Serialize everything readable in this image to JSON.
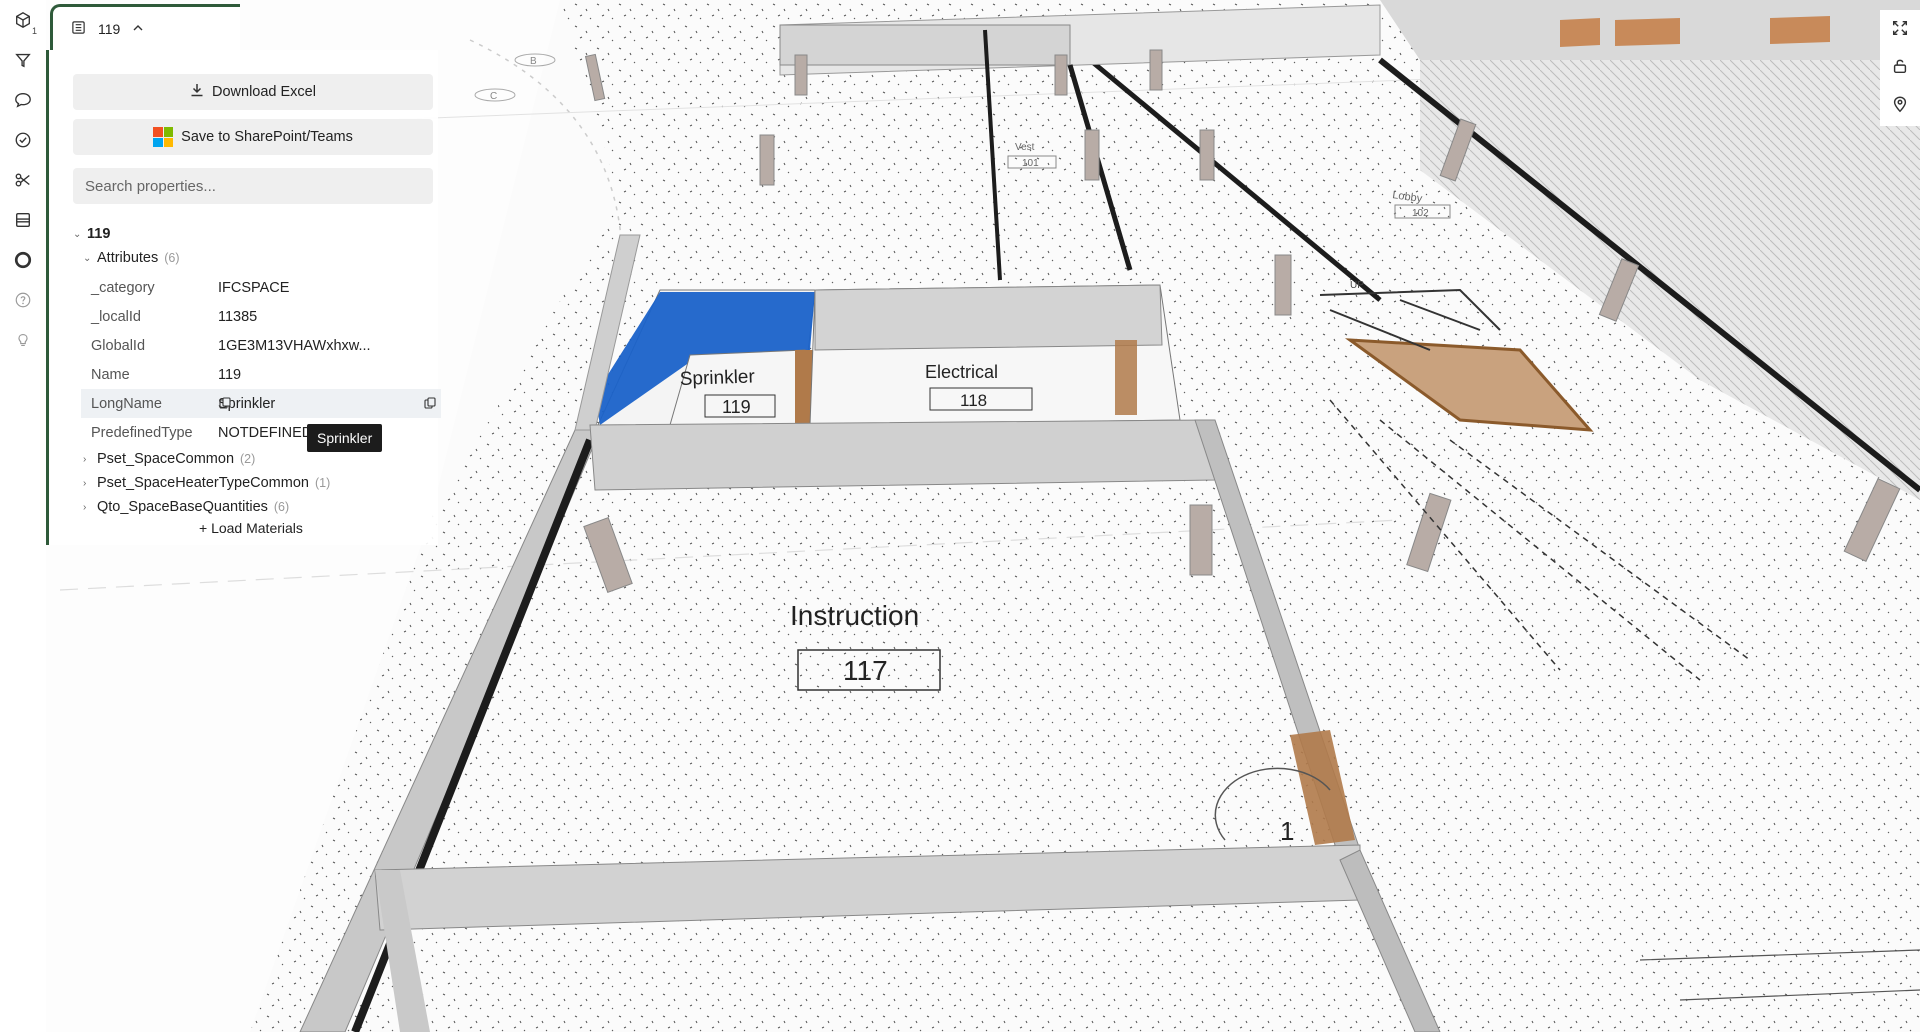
{
  "tab": {
    "title": "119"
  },
  "panel": {
    "download_label": "Download Excel",
    "sharepoint_label": "Save to SharePoint/Teams",
    "search_placeholder": "Search properties...",
    "element_name": "119",
    "attributes": {
      "label": "Attributes",
      "count": "(6)",
      "rows": [
        {
          "key": "_category",
          "value": "IFCSPACE"
        },
        {
          "key": "_localId",
          "value": "11385"
        },
        {
          "key": "GlobalId",
          "value": "1GE3M13VHAWxhxw..."
        },
        {
          "key": "Name",
          "value": "119"
        },
        {
          "key": "LongName",
          "value": "Sprinkler"
        },
        {
          "key": "PredefinedType",
          "value": "NOTDEFINED"
        }
      ]
    },
    "psets": [
      {
        "label": "Pset_SpaceCommon",
        "count": "(2)"
      },
      {
        "label": "Pset_SpaceHeaterTypeCommon",
        "count": "(1)"
      },
      {
        "label": "Qto_SpaceBaseQuantities",
        "count": "(6)"
      }
    ],
    "load_materials": "+ Load Materials",
    "tooltip": "Sprinkler"
  },
  "toolbar": {
    "badge": "1",
    "left_icons": [
      "cube-icon",
      "filter-icon",
      "comment-icon",
      "check-circle-icon",
      "scissors-icon",
      "section-box-icon",
      "ghost-toggle-icon",
      "help-icon",
      "lightbulb-icon"
    ],
    "right_icons": [
      "fullscreen-icon",
      "unlock-icon",
      "location-pin-icon"
    ]
  },
  "model": {
    "room_labels": [
      {
        "name": "Sprinkler",
        "number": "119"
      },
      {
        "name": "Electrical",
        "number": "118"
      },
      {
        "name": "Instruction",
        "number": "117"
      },
      {
        "name": "Vest",
        "number": "101"
      },
      {
        "name": "Lobby",
        "number": "102"
      },
      {
        "name": "UP",
        "number": ""
      },
      {
        "name": "1",
        "number": ""
      }
    ],
    "grid_marks": [
      "B",
      "C"
    ],
    "colors": {
      "selected": "#1a62c9",
      "wall": "#c9c9c9",
      "wall_dark": "#9a9a9a",
      "door": "#b07a4a",
      "glazing": "#1c1c1c"
    }
  }
}
